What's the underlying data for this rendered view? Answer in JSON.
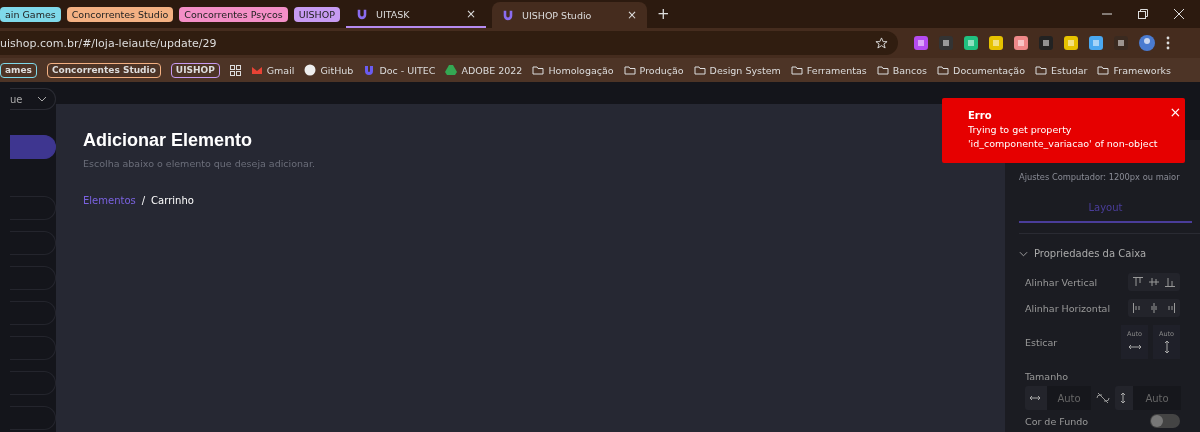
{
  "tab_strip": [
    {
      "kind": "group",
      "label": "ain Games",
      "color": "#7fd9ea"
    },
    {
      "kind": "group",
      "label": "Concorrentes Studio",
      "color": "#f4b183"
    },
    {
      "kind": "group",
      "label": "Concorrentes Psycos",
      "color": "#f48fc7"
    },
    {
      "kind": "group",
      "label": "UISHOP",
      "color": "#c79bf2"
    },
    {
      "kind": "tab",
      "label": "UITASK",
      "selected": false,
      "close": "×"
    },
    {
      "kind": "tab",
      "label": "UISHOP Studio",
      "selected": true,
      "close": "×"
    }
  ],
  "new_tab": "+",
  "address": "uishop.com.br/#/loja-leiaute/update/29",
  "bookmarks": [
    {
      "kind": "group",
      "label": "ames",
      "color": "#7fd9ea"
    },
    {
      "kind": "group",
      "label": "Concorrentes Studio",
      "color": "#f4b183"
    },
    {
      "kind": "group",
      "label": "UISHOP",
      "color": "#c79bf2"
    },
    {
      "kind": "apps"
    },
    {
      "kind": "gmail",
      "label": "Gmail"
    },
    {
      "kind": "github",
      "label": "GitHub"
    },
    {
      "kind": "uitec",
      "label": "Doc - UITEC"
    },
    {
      "kind": "drive",
      "label": "ADOBE 2022"
    },
    {
      "kind": "folder",
      "label": "Homologação"
    },
    {
      "kind": "folder",
      "label": "Produção"
    },
    {
      "kind": "folder",
      "label": "Design System"
    },
    {
      "kind": "folder",
      "label": "Ferramentas"
    },
    {
      "kind": "folder",
      "label": "Bancos"
    },
    {
      "kind": "folder",
      "label": "Documentação"
    },
    {
      "kind": "folder",
      "label": "Estudar"
    },
    {
      "kind": "folder",
      "label": "Frameworks"
    }
  ],
  "sidebar": {
    "select_value": "ue",
    "pills": [
      {
        "selected": true
      },
      {
        "selected": false
      },
      {
        "selected": false
      },
      {
        "selected": false
      },
      {
        "selected": false
      },
      {
        "selected": false
      },
      {
        "selected": false
      },
      {
        "selected": false
      }
    ]
  },
  "modal": {
    "title": "Adicionar Elemento",
    "subtitle": "Escolha abaixo o elemento que deseja adicionar.",
    "breadcrumb": [
      "Elementos",
      "Carrinho"
    ],
    "separator": "/"
  },
  "panel": {
    "subtitle": "Ajustes Computador: 1200px ou maior",
    "tab": "Layout",
    "section": "Propriedades da Caixa",
    "rows": [
      {
        "kind": "align-v",
        "label": "Alinhar Vertical"
      },
      {
        "kind": "align-h",
        "label": "Alinhar Horizontal"
      },
      {
        "kind": "stretch",
        "label": "Esticar",
        "options": [
          "Auto",
          "Auto"
        ]
      }
    ],
    "size": {
      "label": "Tamanho",
      "width": "Auto",
      "height": "Auto"
    },
    "background": {
      "label": "Cor de Fundo",
      "on": false
    }
  },
  "toast": {
    "title": "Erro",
    "lines": [
      "Trying to get property",
      "'id_componente_variacao' of non-object"
    ],
    "close": "×"
  }
}
